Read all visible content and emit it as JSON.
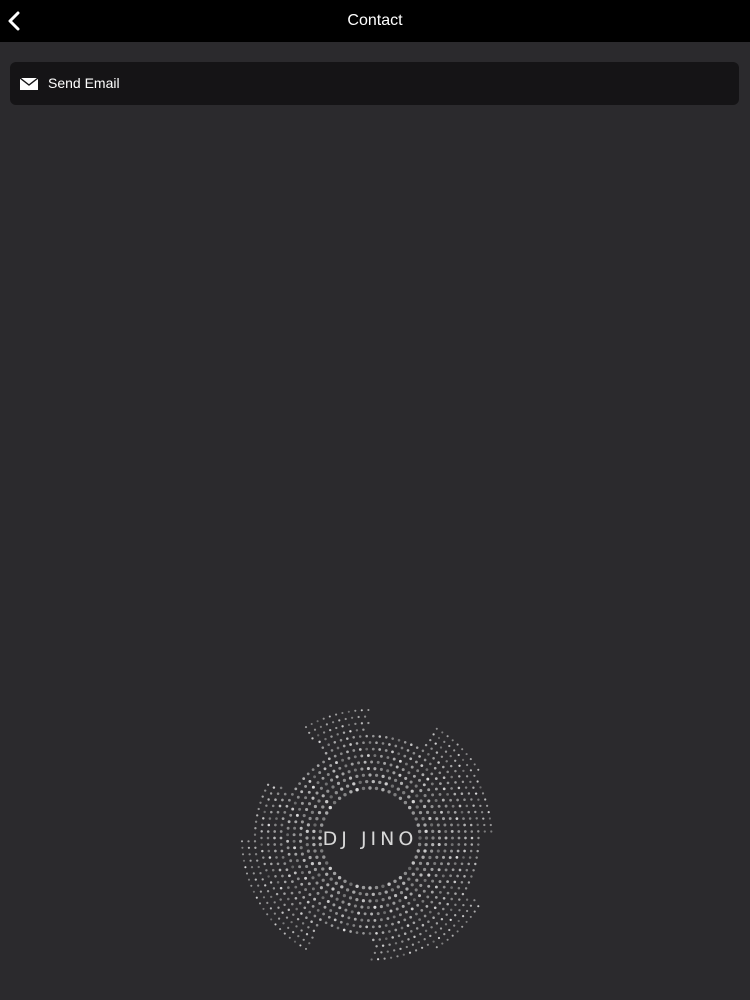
{
  "header": {
    "title": "Contact",
    "back_icon": "chevron-left-icon"
  },
  "contact_items": [
    {
      "label": "Send Email",
      "icon": "envelope-icon"
    }
  ],
  "logo": {
    "text": "DJ JINO"
  },
  "colors": {
    "background": "#2b2a2d",
    "topbar": "#000000",
    "row": "#151416",
    "text": "#ffffff"
  }
}
